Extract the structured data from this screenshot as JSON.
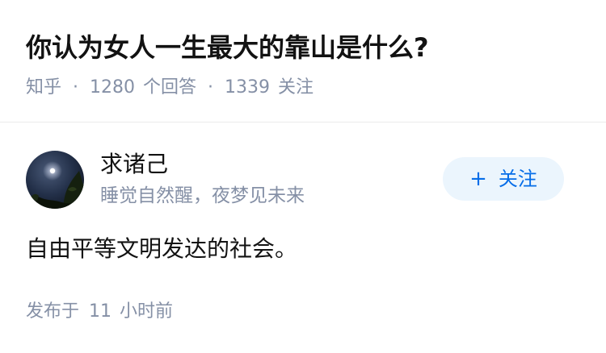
{
  "question": {
    "title": "你认为女人一生最大的靠山是什么?",
    "source": "知乎",
    "separator": "·",
    "answer_count": "1280",
    "answer_label": "个回答",
    "follower_count": "1339",
    "follower_label": "关注"
  },
  "answer": {
    "author": {
      "name": "求诸己",
      "bio": "睡觉自然醒，夜梦见未来",
      "avatar_icon": "moon-night-icon"
    },
    "follow_button": {
      "icon": "plus-icon",
      "icon_glyph": "+",
      "label": "关注"
    },
    "content": "自由平等文明发达的社会。",
    "published": {
      "prefix": "发布于",
      "amount": "11",
      "unit": "小时前"
    }
  },
  "colors": {
    "text_primary": "#121212",
    "text_secondary": "#8590a6",
    "accent": "#056de8",
    "button_bg": "#ebf5fd",
    "divider": "#ececec"
  }
}
